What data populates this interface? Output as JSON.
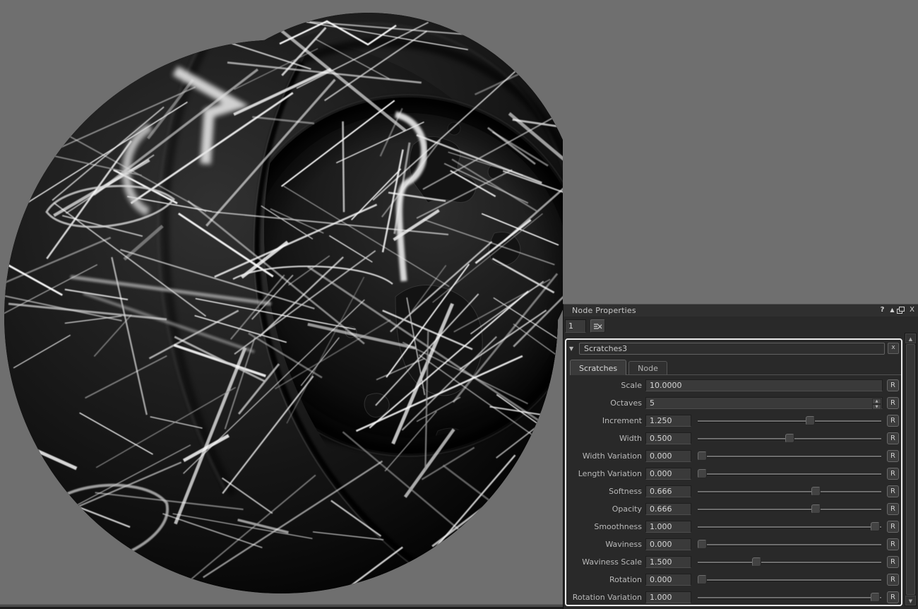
{
  "viewport": {
    "background_color": "#6f6f6f",
    "object": "material-preview-ball",
    "material": {
      "base_color": "#0d0d0d",
      "scratch_color": "#ffffff"
    }
  },
  "panel": {
    "title": "Node Properties",
    "titlebar": {
      "help_glyph": "?",
      "pin_glyph": "▲",
      "close_glyph": "X"
    },
    "toolbar": {
      "index_value": "1"
    },
    "node": {
      "collapse_glyph": "▼",
      "name": "Scratches3",
      "close_label": "x",
      "reset_label": "R",
      "stepper_up_glyph": "▲",
      "stepper_down_glyph": "▼",
      "tabs": [
        {
          "label": "Scratches",
          "active": true
        },
        {
          "label": "Node",
          "active": false
        }
      ],
      "params": [
        {
          "label": "Scale",
          "value": "10.0000",
          "control": "text"
        },
        {
          "label": "Octaves",
          "value": "5",
          "control": "stepper"
        },
        {
          "label": "Increment",
          "value": "1.250",
          "control": "slider",
          "fraction": 0.62
        },
        {
          "label": "Width",
          "value": "0.500",
          "control": "slider",
          "fraction": 0.5
        },
        {
          "label": "Width Variation",
          "value": "0.000",
          "control": "slider",
          "fraction": 0.0
        },
        {
          "label": "Length Variation",
          "value": "0.000",
          "control": "slider",
          "fraction": 0.0
        },
        {
          "label": "Softness",
          "value": "0.666",
          "control": "slider",
          "fraction": 0.65
        },
        {
          "label": "Opacity",
          "value": "0.666",
          "control": "slider",
          "fraction": 0.65
        },
        {
          "label": "Smoothness",
          "value": "1.000",
          "control": "slider",
          "fraction": 0.99
        },
        {
          "label": "Waviness",
          "value": "0.000",
          "control": "slider",
          "fraction": 0.0
        },
        {
          "label": "Waviness Scale",
          "value": "1.500",
          "control": "slider",
          "fraction": 0.31
        },
        {
          "label": "Rotation",
          "value": "0.000",
          "control": "slider",
          "fraction": 0.0
        },
        {
          "label": "Rotation Variation",
          "value": "1.000",
          "control": "slider",
          "fraction": 0.99
        }
      ]
    },
    "scrollbar": {
      "up_glyph": "▲",
      "down_glyph": "▼"
    }
  }
}
